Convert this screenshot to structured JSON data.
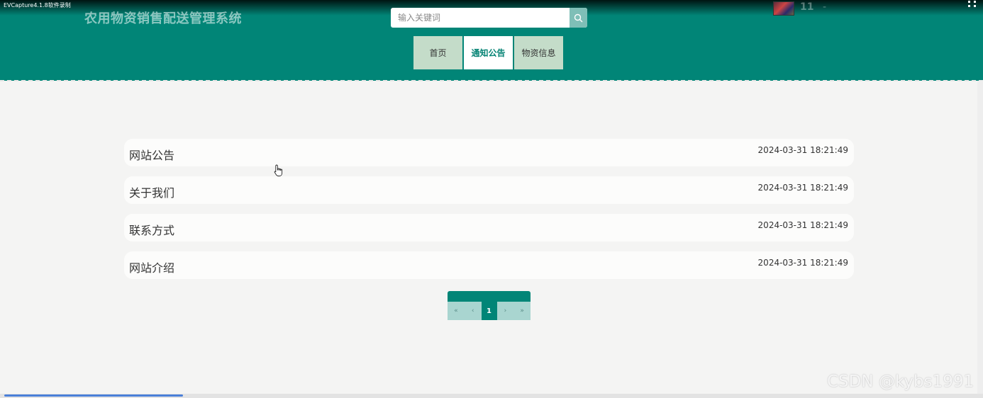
{
  "capture": {
    "label": "EVCapture4.1.8软件录制"
  },
  "site": {
    "title": "农用物资销售配送管理系统"
  },
  "search": {
    "placeholder": "输入关键词"
  },
  "user": {
    "name": "11",
    "separator": "-"
  },
  "nav": {
    "items": [
      {
        "label": "首页"
      },
      {
        "label": "通知公告"
      },
      {
        "label": "物资信息"
      }
    ],
    "active": "通知公告"
  },
  "notices": [
    {
      "title": "网站公告",
      "time": "2024-03-31 18:21:49"
    },
    {
      "title": "关于我们",
      "time": "2024-03-31 18:21:49"
    },
    {
      "title": "联系方式",
      "time": "2024-03-31 18:21:49"
    },
    {
      "title": "网站介绍",
      "time": "2024-03-31 18:21:49"
    }
  ],
  "pagination": {
    "first": "«",
    "prev": "‹",
    "current": "1",
    "next": "›",
    "last": "»"
  },
  "watermark": {
    "text": "CSDN @kybs1991"
  },
  "colors": {
    "header": "#018577",
    "nav_inactive": "#c4dcc9",
    "nav_active_text": "#058374",
    "page_bg": "#f4f4f3"
  }
}
